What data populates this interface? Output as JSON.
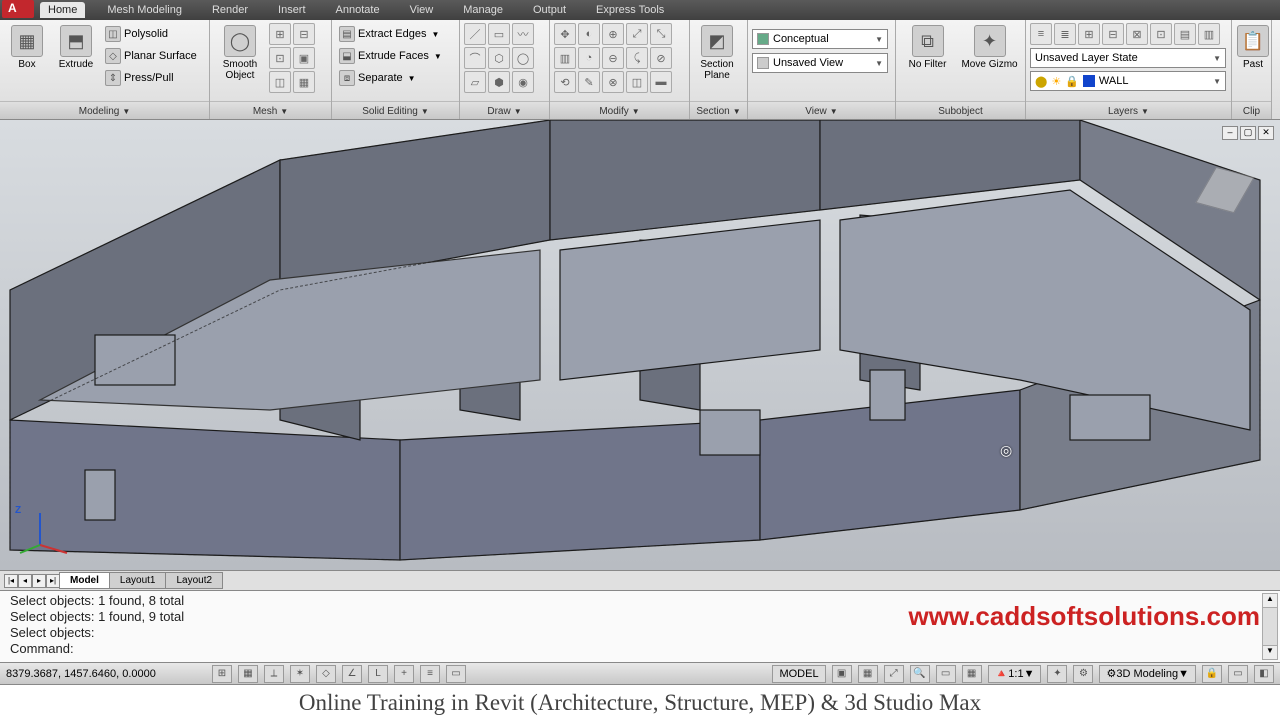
{
  "menu": {
    "tabs": [
      "Home",
      "Mesh Modeling",
      "Render",
      "Insert",
      "Annotate",
      "View",
      "Manage",
      "Output",
      "Express Tools"
    ],
    "active": "Home"
  },
  "ribbon": {
    "modeling": {
      "box": "Box",
      "extrude": "Extrude",
      "polysolid": "Polysolid",
      "planar": "Planar Surface",
      "presspull": "Press/Pull",
      "title": "Modeling"
    },
    "mesh": {
      "smooth": "Smooth\nObject",
      "title": "Mesh"
    },
    "solidedit": {
      "extract": "Extract Edges",
      "extrudefaces": "Extrude Faces",
      "separate": "Separate",
      "title": "Solid Editing"
    },
    "draw": {
      "title": "Draw"
    },
    "modify": {
      "title": "Modify"
    },
    "section": {
      "plane": "Section\nPlane",
      "title": "Section"
    },
    "view": {
      "visualstyle": "Conceptual",
      "savedview": "Unsaved View",
      "title": "View"
    },
    "subobject": {
      "nofilter": "No Filter",
      "movegizmo": "Move Gizmo",
      "title": "Subobject"
    },
    "layers": {
      "state": "Unsaved Layer State",
      "current": "WALL",
      "title": "Layers"
    },
    "clipboard": {
      "paste": "Past",
      "title": "Clip"
    }
  },
  "viewport": {
    "cursor_hint": "◎"
  },
  "layout_tabs": {
    "model": "Model",
    "l1": "Layout1",
    "l2": "Layout2"
  },
  "command": {
    "lines": [
      "Select objects: 1 found, 8 total",
      "Select objects: 1 found, 9 total",
      "Select objects:",
      "Command:"
    ],
    "watermark": "www.caddsoftsolutions.com"
  },
  "status": {
    "coords": "8379.3687, 1457.6460, 0.0000",
    "model": "MODEL",
    "scale": "1:1",
    "workspace": "3D Modeling"
  },
  "footer": "Online Training in Revit (Architecture, Structure, MEP) & 3d Studio Max"
}
